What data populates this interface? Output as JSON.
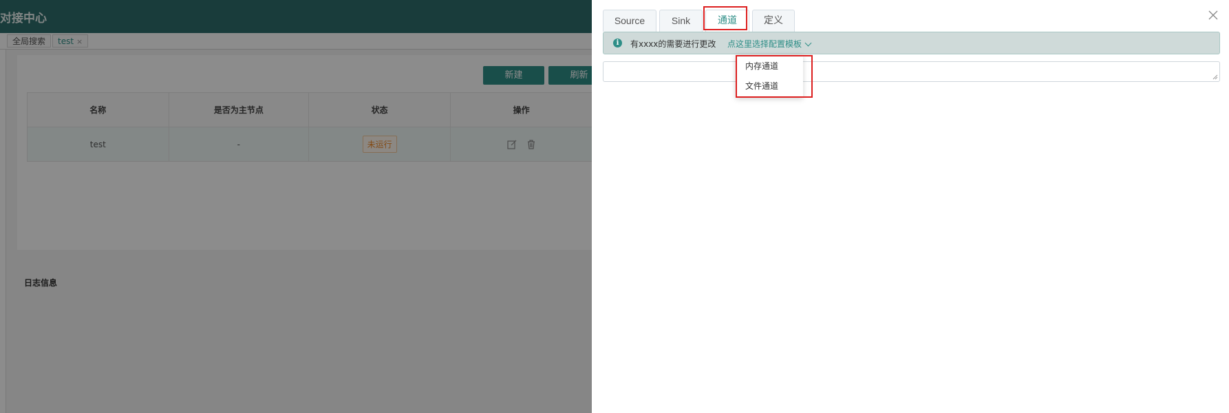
{
  "app": {
    "title": "对接中心"
  },
  "tag_bar": {
    "global_search": "全局搜索",
    "test_tag": "test"
  },
  "toolbar": {
    "new_label": "新建",
    "refresh_label": "刷新"
  },
  "table": {
    "headers": [
      "名称",
      "是否为主节点",
      "状态",
      "操作"
    ],
    "rows": [
      {
        "name": "test",
        "is_master": "-",
        "status": "未运行"
      }
    ]
  },
  "log_section": {
    "title": "日志信息"
  },
  "drawer": {
    "tabs": [
      {
        "label": "Source",
        "active": false
      },
      {
        "label": "Sink",
        "active": false
      },
      {
        "label": "通道",
        "active": true
      },
      {
        "label": "定义",
        "active": false
      }
    ],
    "alert": {
      "text": "有xxxx的需要进行更改",
      "link": "点这里选择配置模板"
    },
    "textarea_value": "",
    "dropdown": {
      "items": [
        "内存通道",
        "文件通道"
      ]
    }
  },
  "colors": {
    "primary": "#2e8e87",
    "topbar": "#2e6e6c",
    "highlight": "#dc1e1e",
    "warning": "#ee8a2a"
  },
  "icons": {
    "close": "close-icon",
    "info": "info-icon",
    "edit": "edit-icon",
    "delete": "trash-icon",
    "chevron": "chevron-down-icon"
  }
}
